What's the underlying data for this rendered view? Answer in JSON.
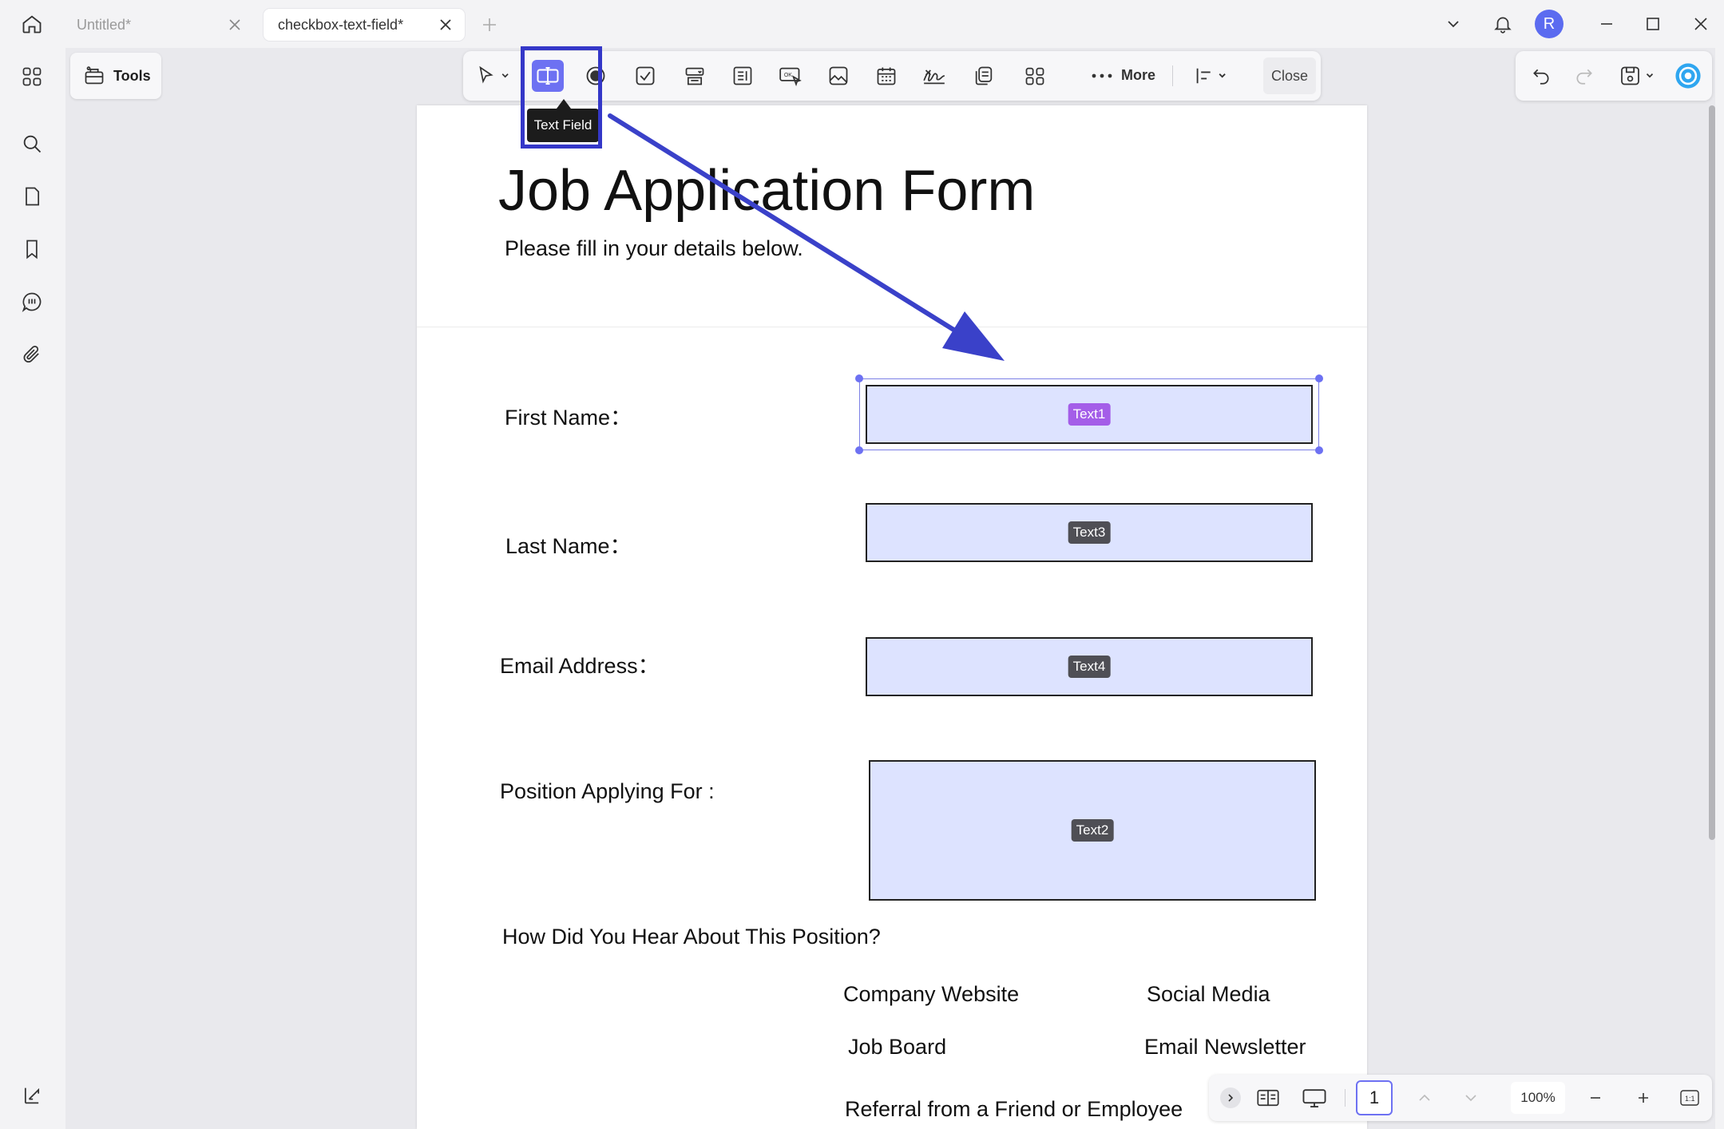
{
  "tabs": [
    {
      "label": "Untitled*",
      "active": false
    },
    {
      "label": "checkbox-text-field*",
      "active": true
    }
  ],
  "user": {
    "initial": "R"
  },
  "tools_label": "Tools",
  "toolbar": {
    "more_label": "More",
    "close_label": "Close",
    "active_tool": "Text Field",
    "tooltip": "Text Field"
  },
  "form": {
    "title": "Job Application Form",
    "subtitle": "Please fill in your details below.",
    "fields": [
      {
        "label": "First Name：",
        "field_name": "Text1",
        "selected": true
      },
      {
        "label": "Last Name：",
        "field_name": "Text3",
        "selected": false
      },
      {
        "label": "Email Address：",
        "field_name": "Text4",
        "selected": false
      },
      {
        "label": "Position Applying For :",
        "field_name": "Text2",
        "selected": false
      }
    ],
    "question": "How Did You Hear About This Position?",
    "options": [
      "Company Website",
      "Social Media",
      "Job Board",
      "Email Newsletter",
      "Referral from a Friend or Employee"
    ]
  },
  "bottom": {
    "page_number": "1",
    "zoom": "100%"
  },
  "colors": {
    "accent": "#6d71f2",
    "highlight": "#3437c8",
    "field_fill": "#dde3ff",
    "selected_badge": "#a45ee8"
  }
}
